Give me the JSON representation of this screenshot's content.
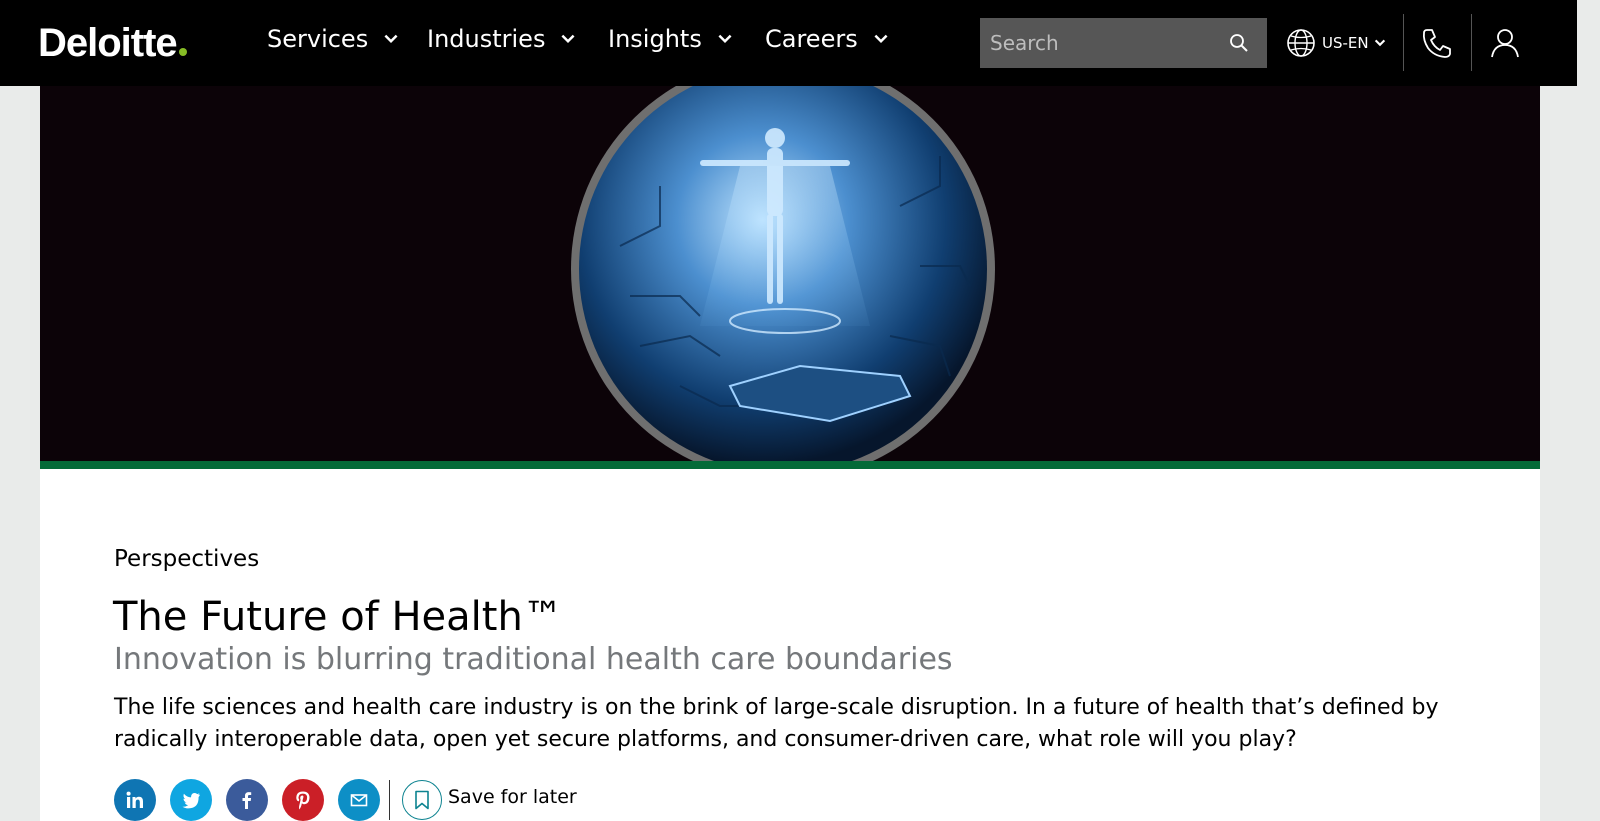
{
  "header": {
    "logo": "Deloitte",
    "nav": [
      {
        "label": "Services"
      },
      {
        "label": "Industries"
      },
      {
        "label": "Insights"
      },
      {
        "label": "Careers"
      }
    ],
    "search_placeholder": "Search",
    "locale": "US-EN",
    "icons": [
      "search-icon",
      "globe-icon",
      "phone-icon",
      "user-icon"
    ]
  },
  "article": {
    "eyebrow": "Perspectives",
    "title": "The Future of Health™",
    "subtitle": "Innovation is blurring traditional health care boundaries",
    "body": "The life sciences and health care industry is on the brink of large-scale disruption. In a future of health that’s defined by radically interoperable data, open yet secure platforms, and consumer-driven care, what role will you play?",
    "share": [
      "linkedin-icon",
      "twitter-icon",
      "facebook-icon",
      "pinterest-icon",
      "email-icon"
    ],
    "save_label": "Save for later"
  },
  "colors": {
    "brand_green": "#86bc25",
    "hero_bar": "#046a38",
    "linkedin": "#0f75b3",
    "twitter": "#0fa6e1",
    "facebook": "#3b5b9b",
    "pinterest": "#cb1f27",
    "email": "#0d8fc6",
    "save_ring": "#0d8390"
  }
}
